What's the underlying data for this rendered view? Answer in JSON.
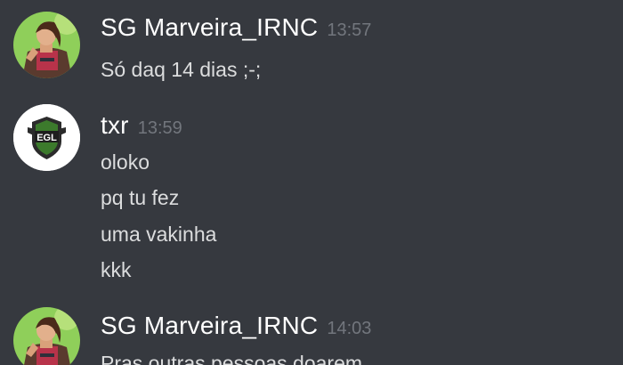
{
  "messages": [
    {
      "author": "SG Marveira_IRNC",
      "time": "13:57",
      "avatar": "fortnite-character-avatar",
      "lines": [
        "Só daq 14 dias ;-;"
      ]
    },
    {
      "author": "txr",
      "time": "13:59",
      "avatar": "egl-shield-logo-avatar",
      "lines": [
        "oloko",
        "pq tu fez",
        "uma vakinha",
        "kkk"
      ]
    },
    {
      "author": "SG Marveira_IRNC",
      "time": "14:03",
      "avatar": "fortnite-character-avatar",
      "lines": [
        "Pras outras pessoas doarem"
      ]
    }
  ],
  "logo_text": "EGL",
  "colors": {
    "background": "#36393f",
    "username": "#ffffff",
    "timestamp": "#72767d",
    "message_text": "#dcddde"
  }
}
